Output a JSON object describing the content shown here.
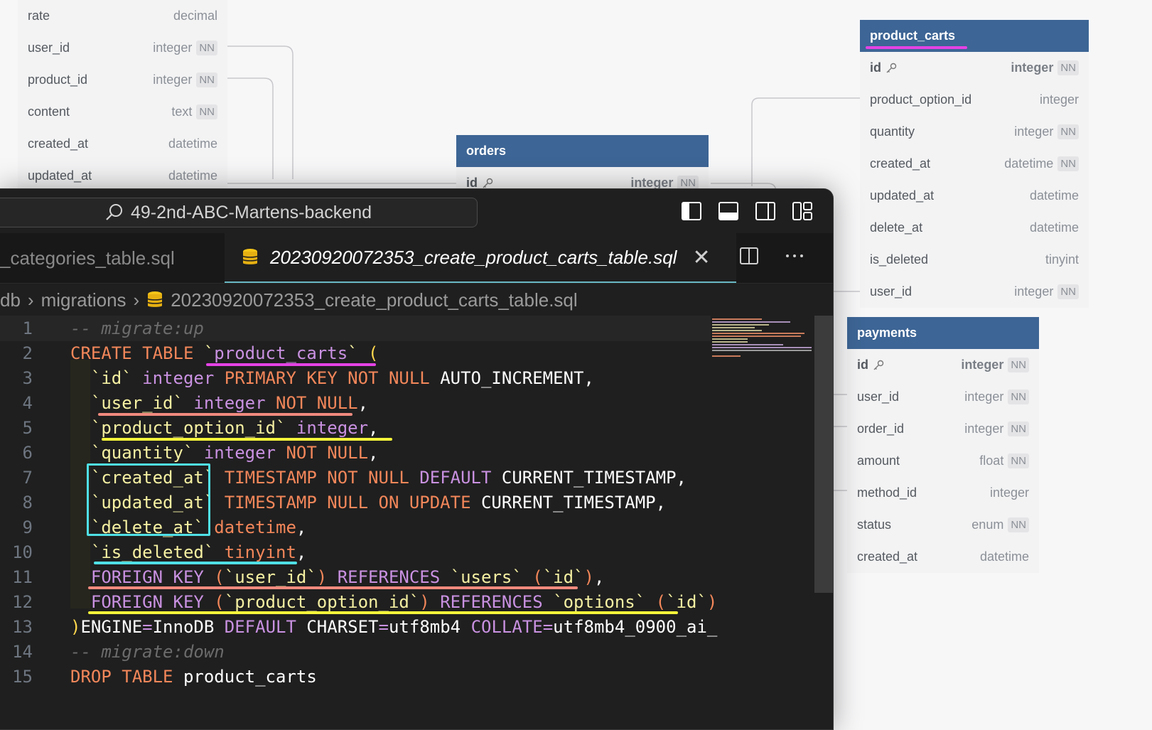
{
  "erd": {
    "reviews_table": {
      "rows": [
        {
          "name": "rate",
          "type": "decimal",
          "nn": ""
        },
        {
          "name": "user_id",
          "type": "integer",
          "nn": "NN"
        },
        {
          "name": "product_id",
          "type": "integer",
          "nn": "NN"
        },
        {
          "name": "content",
          "type": "text",
          "nn": "NN"
        },
        {
          "name": "created_at",
          "type": "datetime",
          "nn": ""
        },
        {
          "name": "updated_at",
          "type": "datetime",
          "nn": ""
        }
      ]
    },
    "orders_table": {
      "title": "orders",
      "rows": [
        {
          "name": "id",
          "type": "integer",
          "nn": "NN"
        }
      ]
    },
    "product_carts_table": {
      "title": "product_carts",
      "rows": [
        {
          "name": "id",
          "type": "integer",
          "nn": "NN"
        },
        {
          "name": "product_option_id",
          "type": "integer",
          "nn": ""
        },
        {
          "name": "quantity",
          "type": "integer",
          "nn": "NN"
        },
        {
          "name": "created_at",
          "type": "datetime",
          "nn": "NN"
        },
        {
          "name": "updated_at",
          "type": "datetime",
          "nn": ""
        },
        {
          "name": "delete_at",
          "type": "datetime",
          "nn": ""
        },
        {
          "name": "is_deleted",
          "type": "tinyint",
          "nn": ""
        },
        {
          "name": "user_id",
          "type": "integer",
          "nn": "NN"
        }
      ]
    },
    "payments_table": {
      "title": "payments",
      "rows": [
        {
          "name": "id",
          "type": "integer",
          "nn": "NN"
        },
        {
          "name": "user_id",
          "type": "integer",
          "nn": "NN"
        },
        {
          "name": "order_id",
          "type": "integer",
          "nn": "NN"
        },
        {
          "name": "amount",
          "type": "float",
          "nn": "NN"
        },
        {
          "name": "method_id",
          "type": "integer",
          "nn": ""
        },
        {
          "name": "status",
          "type": "enum",
          "nn": "NN"
        },
        {
          "name": "created_at",
          "type": "datetime",
          "nn": ""
        }
      ]
    }
  },
  "editor": {
    "search_text": "49-2nd-ABC-Martens-backend",
    "tabs": {
      "inactive": "_categories_table.sql",
      "active": "20230920072353_create_product_carts_table.sql",
      "close": "✕"
    },
    "breadcrumb": {
      "root": "db",
      "folder": "migrations",
      "file": "20230920072353_create_product_carts_table.sql",
      "sep": "›"
    },
    "line_numbers": [
      "1",
      "2",
      "3",
      "4",
      "5",
      "6",
      "7",
      "8",
      "9",
      "10",
      "11",
      "12",
      "13",
      "14",
      "15"
    ],
    "lines": [
      [
        [
          "cm",
          "-- migrate:up"
        ]
      ],
      [
        [
          "kw",
          "CREATE TABLE "
        ],
        [
          "id",
          "`"
        ],
        [
          "kp",
          "product_carts"
        ],
        [
          "id",
          "`"
        ],
        [
          "yl",
          " ("
        ]
      ],
      [
        [
          "id",
          "  `id`"
        ],
        [
          "tx",
          " "
        ],
        [
          "kp",
          "integer "
        ],
        [
          "kw",
          "PRIMARY KEY NOT NULL "
        ],
        [
          "tx",
          "AUTO_INCREMENT,"
        ]
      ],
      [
        [
          "id",
          "  `user_id`"
        ],
        [
          "tx",
          " "
        ],
        [
          "kp",
          "integer "
        ],
        [
          "kw",
          "NOT NULL"
        ],
        [
          "tx",
          ","
        ]
      ],
      [
        [
          "id",
          "  `product_option_id`"
        ],
        [
          "tx",
          " "
        ],
        [
          "kp",
          "integer"
        ],
        [
          "tx",
          ","
        ]
      ],
      [
        [
          "id",
          "  `quantity`"
        ],
        [
          "tx",
          " "
        ],
        [
          "kp",
          "integer "
        ],
        [
          "kw",
          "NOT NULL"
        ],
        [
          "tx",
          ","
        ]
      ],
      [
        [
          "id",
          "  `created_at`"
        ],
        [
          "tx",
          " "
        ],
        [
          "kw",
          "TIMESTAMP NOT NULL "
        ],
        [
          "kp",
          "DEFAULT "
        ],
        [
          "tx",
          "CURRENT_TIMESTAMP,"
        ]
      ],
      [
        [
          "id",
          "  `updated_at`"
        ],
        [
          "tx",
          " "
        ],
        [
          "kw",
          "TIMESTAMP NULL ON UPDATE "
        ],
        [
          "tx",
          "CURRENT_TIMESTAMP,"
        ]
      ],
      [
        [
          "id",
          "  `delete_at`"
        ],
        [
          "tx",
          " "
        ],
        [
          "kw",
          "datetime"
        ],
        [
          "tx",
          ","
        ]
      ],
      [
        [
          "id",
          "  `is_deleted`"
        ],
        [
          "tx",
          " "
        ],
        [
          "kw",
          "tinyint"
        ],
        [
          "tx",
          ","
        ]
      ],
      [
        [
          "tx",
          "  "
        ],
        [
          "kp",
          "FOREIGN KEY "
        ],
        [
          "kw",
          "("
        ],
        [
          "id",
          "`user_id`"
        ],
        [
          "kw",
          ") "
        ],
        [
          "kp",
          "REFERENCES "
        ],
        [
          "id",
          "`users` "
        ],
        [
          "kw",
          "("
        ],
        [
          "id",
          "`id`"
        ],
        [
          "kw",
          ")"
        ],
        [
          "tx",
          ","
        ]
      ],
      [
        [
          "tx",
          "  "
        ],
        [
          "kp",
          "FOREIGN KEY "
        ],
        [
          "kw",
          "("
        ],
        [
          "id",
          "`product_option_id`"
        ],
        [
          "kw",
          ") "
        ],
        [
          "kp",
          "REFERENCES "
        ],
        [
          "id",
          "`options` "
        ],
        [
          "kw",
          "("
        ],
        [
          "id",
          "`id`"
        ],
        [
          "kw",
          ")"
        ]
      ],
      [
        [
          "yl",
          ")"
        ],
        [
          "tx",
          "ENGINE"
        ],
        [
          "kp",
          "="
        ],
        [
          "tx",
          "InnoDB "
        ],
        [
          "kp",
          "DEFAULT "
        ],
        [
          "tx",
          "CHARSET"
        ],
        [
          "kp",
          "="
        ],
        [
          "tx",
          "utf8mb4 "
        ],
        [
          "kp",
          "COLLATE"
        ],
        [
          "kp",
          "="
        ],
        [
          "tx",
          "utf8mb4_0900_ai_"
        ]
      ],
      [
        [
          "cm",
          "-- migrate:down"
        ]
      ],
      [
        [
          "kw",
          "DROP TABLE "
        ],
        [
          "tx",
          "product_carts"
        ]
      ]
    ]
  },
  "colors": {
    "magenta": "#e442e4",
    "salmon": "#f08a7e",
    "yellow": "#f5f53a",
    "cyan": "#4fe0e6",
    "header_blue": "#3d6595"
  }
}
